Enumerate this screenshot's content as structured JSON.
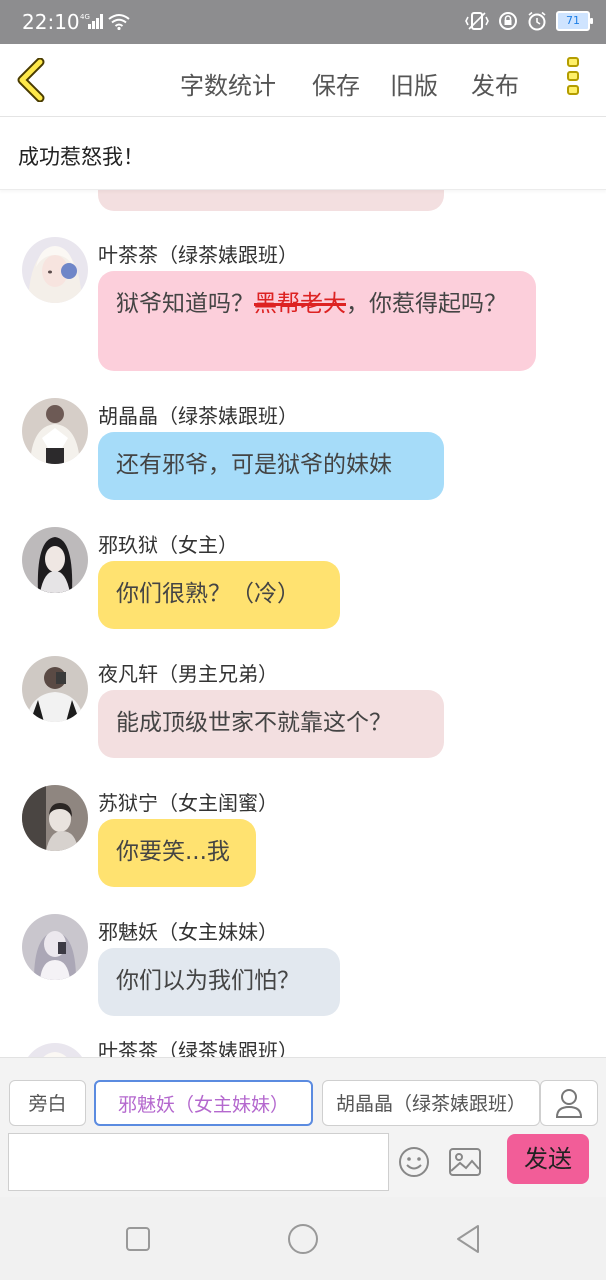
{
  "status_bar": {
    "time": "22:10",
    "network": "4G",
    "battery": "71"
  },
  "toolbar": {
    "word_count": "字数统计",
    "save": "保存",
    "old_version": "旧版",
    "publish": "发布"
  },
  "chat_title": "成功惹怒我！",
  "messages": [
    {
      "sender": "叶茶茶（绿茶婊跟班）",
      "text_before": "狱爷知道吗？",
      "text_struck": "黑帮老大",
      "text_after": "，你惹得起吗？",
      "bubble_color": "#fccfdb"
    },
    {
      "sender": "胡晶晶（绿茶婊跟班）",
      "text": "还有邪爷，可是狱爷的妹妹",
      "bubble_color": "#a6dcf9"
    },
    {
      "sender": "邪玖狱（女主）",
      "text": "你们很熟？（冷）",
      "bubble_color": "#ffe270"
    },
    {
      "sender": "夜凡轩（男主兄弟）",
      "text": "能成顶级世家不就靠这个？",
      "bubble_color": "#f3dfe0"
    },
    {
      "sender": "苏狱宁（女主闺蜜）",
      "text": "你要笑...我",
      "bubble_color": "#ffe270"
    },
    {
      "sender": "邪魅妖（女主妹妹）",
      "text": "你们以为我们怕？",
      "bubble_color": "#e2e8ef"
    },
    {
      "sender": "叶茶茶（绿茶婊跟班）"
    }
  ],
  "input_bar": {
    "roles": [
      "旁白",
      "邪魅妖（女主妹妹）",
      "胡晶晶（绿茶婊跟班）"
    ],
    "input_value": "",
    "send": "发送"
  }
}
